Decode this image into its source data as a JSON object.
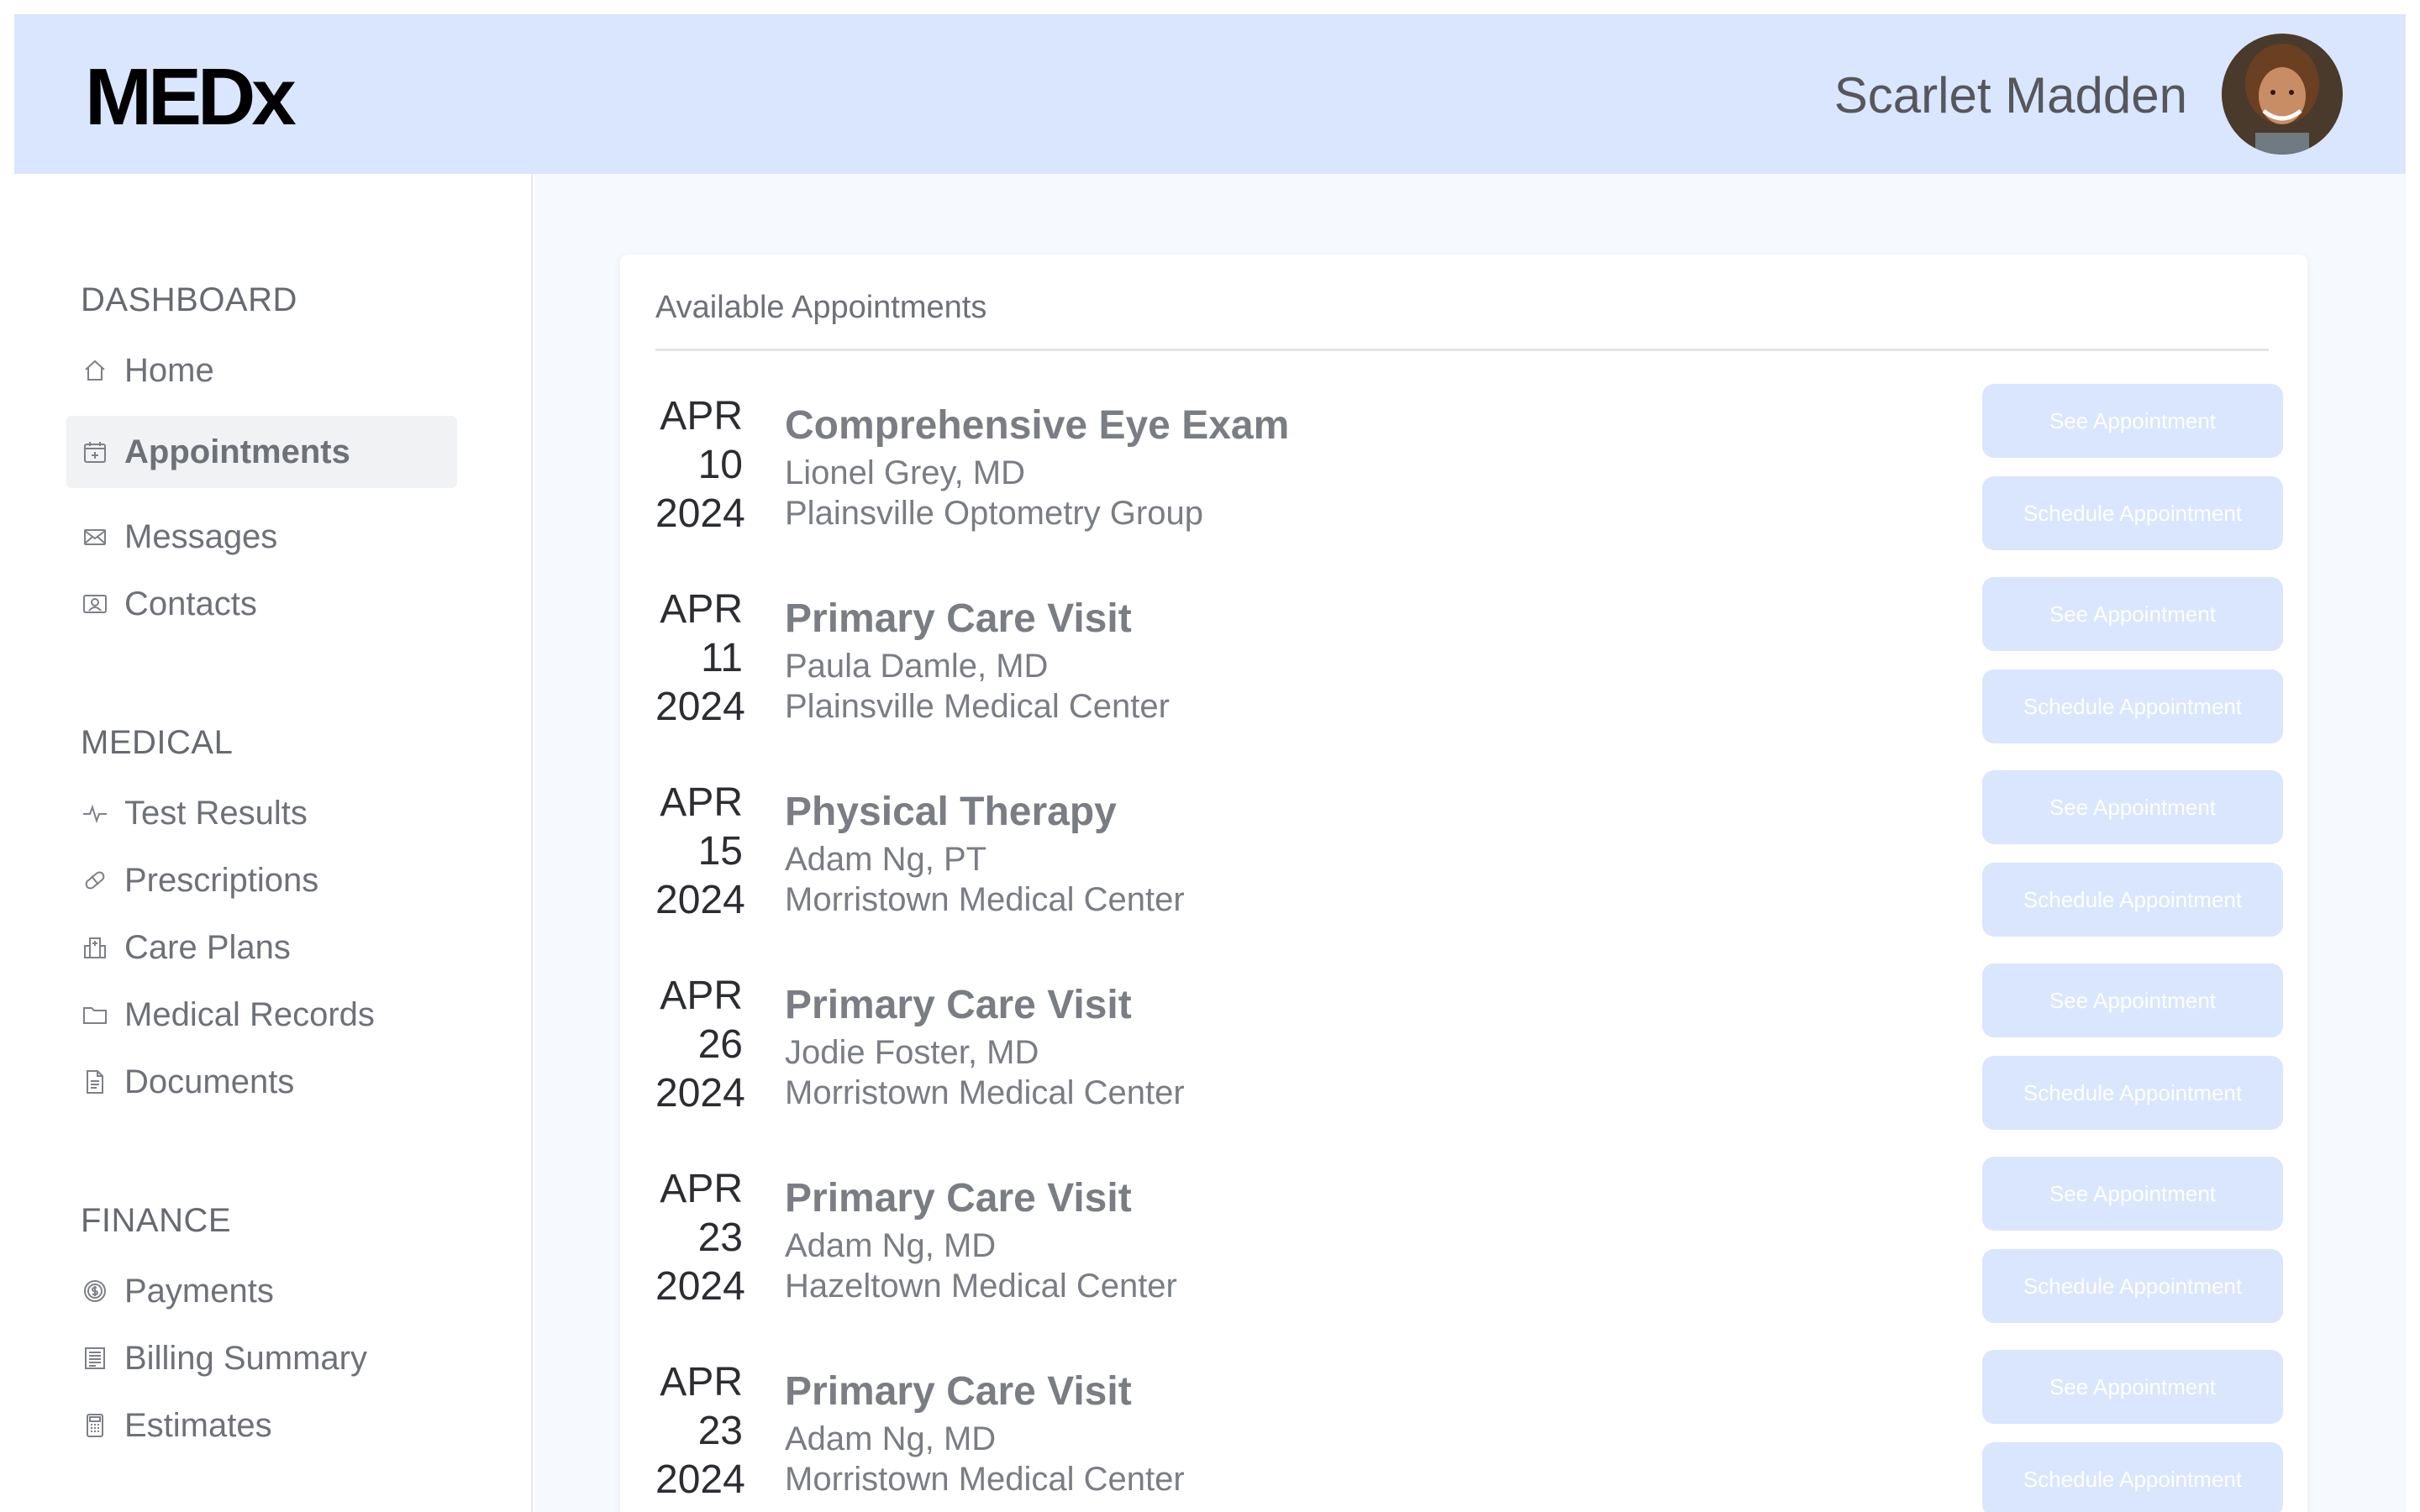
{
  "header": {
    "logo": "MEDx",
    "user_name": "Scarlet Madden"
  },
  "sidebar": {
    "sections": [
      {
        "title": "DASHBOARD",
        "items": [
          {
            "label": "Home",
            "icon": "home-icon",
            "active": false
          },
          {
            "label": "Appointments",
            "icon": "calendar-plus-icon",
            "active": true
          },
          {
            "label": "Messages",
            "icon": "envelope-icon",
            "active": false
          },
          {
            "label": "Contacts",
            "icon": "contact-card-icon",
            "active": false
          }
        ]
      },
      {
        "title": "MEDICAL",
        "items": [
          {
            "label": "Test Results",
            "icon": "pulse-icon",
            "active": false
          },
          {
            "label": "Prescriptions",
            "icon": "pill-icon",
            "active": false
          },
          {
            "label": "Care Plans",
            "icon": "hospital-icon",
            "active": false
          },
          {
            "label": "Medical Records",
            "icon": "folder-icon",
            "active": false
          },
          {
            "label": "Documents",
            "icon": "document-icon",
            "active": false
          }
        ]
      },
      {
        "title": "FINANCE",
        "items": [
          {
            "label": "Payments",
            "icon": "dollar-coin-icon",
            "active": false
          },
          {
            "label": "Billing Summary",
            "icon": "receipt-icon",
            "active": false
          },
          {
            "label": "Estimates",
            "icon": "calculator-icon",
            "active": false
          }
        ]
      }
    ]
  },
  "main": {
    "card_title": "Available Appointments",
    "see_label": "See Appointment",
    "schedule_label": "Schedule Appointment",
    "appointments": [
      {
        "month": "APR",
        "day": "10",
        "year": "2024",
        "title": "Comprehensive Eye Exam",
        "provider": "Lionel Grey, MD",
        "location": "Plainsville Optometry Group"
      },
      {
        "month": "APR",
        "day": "11",
        "year": "2024",
        "title": "Primary Care Visit",
        "provider": "Paula Damle, MD",
        "location": "Plainsville Medical Center"
      },
      {
        "month": "APR",
        "day": "15",
        "year": "2024",
        "title": "Physical Therapy",
        "provider": "Adam Ng, PT",
        "location": "Morristown Medical Center"
      },
      {
        "month": "APR",
        "day": "26",
        "year": "2024",
        "title": "Primary Care Visit",
        "provider": "Jodie Foster, MD",
        "location": "Morristown Medical Center"
      },
      {
        "month": "APR",
        "day": "23",
        "year": "2024",
        "title": "Primary Care Visit",
        "provider": "Adam Ng, MD",
        "location": "Hazeltown Medical Center"
      },
      {
        "month": "APR",
        "day": "23",
        "year": "2024",
        "title": "Primary Care Visit",
        "provider": "Adam Ng, MD",
        "location": "Morristown Medical Center"
      }
    ]
  },
  "colors": {
    "header_bg": "#d9e6fd",
    "button_bg": "#d9e6fd",
    "main_bg": "#f6f9fe"
  }
}
